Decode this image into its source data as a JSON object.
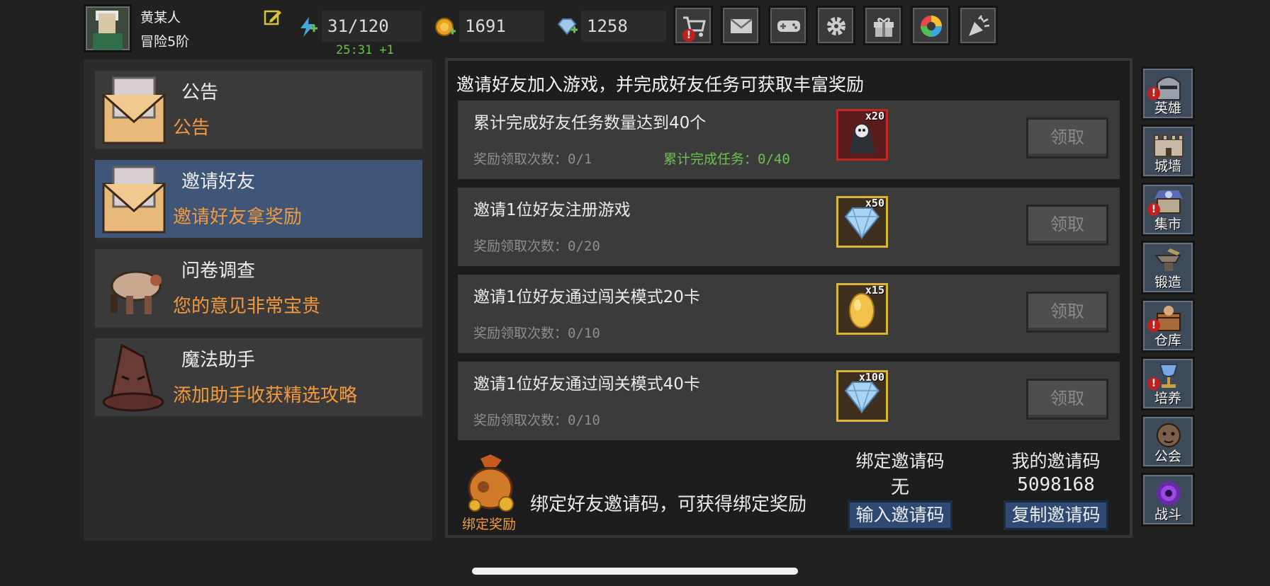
{
  "user": {
    "name": "黄某人",
    "rank": "冒险5阶"
  },
  "resources": {
    "energy": "31/120",
    "energy_timer": "25:31 +1",
    "gold": "1691",
    "gems": "1258"
  },
  "top_buttons": [
    {
      "icon": "shop-cart-icon",
      "alert": true
    },
    {
      "icon": "mail-icon",
      "alert": false
    },
    {
      "icon": "gamepad-icon",
      "alert": false
    },
    {
      "icon": "settings-gear-icon",
      "alert": false
    },
    {
      "icon": "gift-icon",
      "alert": false
    },
    {
      "icon": "color-wheel-icon",
      "alert": false
    },
    {
      "icon": "party-popper-icon",
      "alert": false
    }
  ],
  "menu": [
    {
      "title": "公告",
      "subtitle": "公告",
      "icon": "envelope-icon",
      "active": false
    },
    {
      "title": "邀请好友",
      "subtitle": "邀请好友拿奖励",
      "icon": "envelope-icon",
      "active": true
    },
    {
      "title": "问卷调查",
      "subtitle": "您的意见非常宝贵",
      "icon": "creature-icon",
      "active": false
    },
    {
      "title": "魔法助手",
      "subtitle": "添加助手收获精选攻略",
      "icon": "wizard-hat-icon",
      "active": false
    }
  ],
  "main": {
    "header": "邀请好友加入游戏，并完成好友任务可获取丰富奖励",
    "tasks": [
      {
        "title": "累计完成好友任务数量达到40个",
        "count": "奖励领取次数：0/1",
        "progress": "累计完成任务：0/40",
        "reward_qty": "x20",
        "reward_icon": "reaper-icon",
        "button": "领取"
      },
      {
        "title": "邀请1位好友注册游戏",
        "count": "奖励领取次数：0/20",
        "progress": "",
        "reward_qty": "x50",
        "reward_icon": "diamond-icon",
        "button": "领取"
      },
      {
        "title": "邀请1位好友通过闯关模式20卡",
        "count": "奖励领取次数：0/10",
        "progress": "",
        "reward_qty": "x15",
        "reward_icon": "golden-egg-icon",
        "button": "领取"
      },
      {
        "title": "邀请1位好友通过闯关模式40卡",
        "count": "奖励领取次数：0/10",
        "progress": "",
        "reward_qty": "x100",
        "reward_icon": "diamond-icon",
        "button": "领取"
      }
    ],
    "bind": {
      "label": "绑定奖励",
      "text": "绑定好友邀请码，可获得绑定奖励",
      "bound_head": "绑定邀请码",
      "bound_value": "无",
      "bound_button": "输入邀请码",
      "my_head": "我的邀请码",
      "my_value": "5098168",
      "my_button": "复制邀请码"
    }
  },
  "nav": [
    {
      "label": "英雄",
      "icon": "knight-helmet-icon",
      "alert": true
    },
    {
      "label": "城墙",
      "icon": "castle-wall-icon",
      "alert": false
    },
    {
      "label": "集市",
      "icon": "market-stall-icon",
      "alert": true
    },
    {
      "label": "锻造",
      "icon": "anvil-icon",
      "alert": false
    },
    {
      "label": "仓库",
      "icon": "treasure-chest-icon",
      "alert": true
    },
    {
      "label": "培养",
      "icon": "goblet-icon",
      "alert": true
    },
    {
      "label": "公会",
      "icon": "guild-beast-icon",
      "alert": false
    },
    {
      "label": "战斗",
      "icon": "portal-icon",
      "alert": false
    }
  ]
}
